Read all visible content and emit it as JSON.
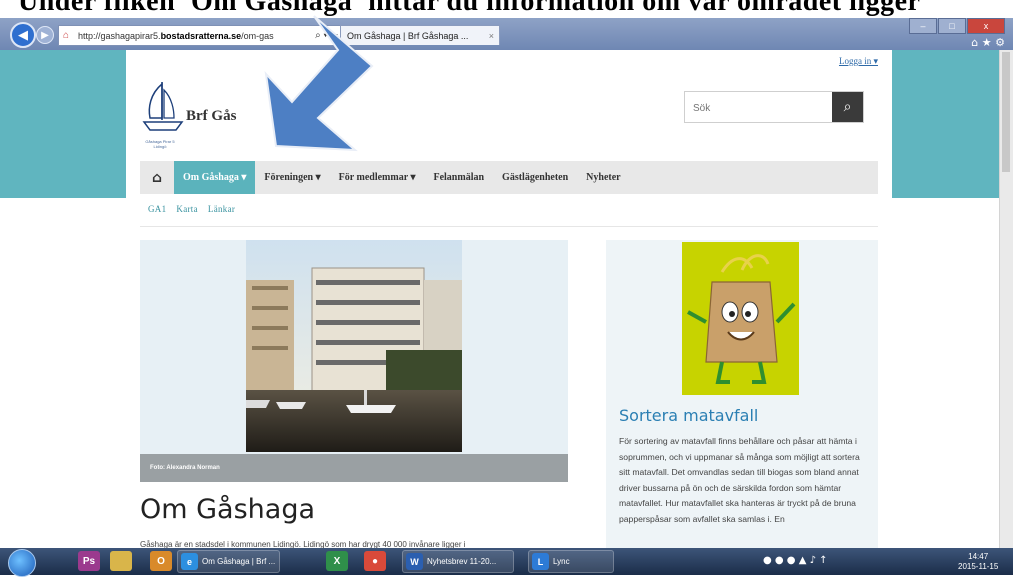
{
  "caption": "Under fliken 'Om Gåshaga' hittar du information om var området ligger",
  "browser": {
    "url_plain": "http://gashagapirar5.",
    "url_bold": "bostadsratterna.se",
    "url_rest": "/om-gas",
    "url_tools": "⌕ ▾ ☰",
    "tab_title": "Om Gåshaga | Brf Gåshaga ...",
    "tab_close": "×",
    "win_min": "–",
    "win_max": "□",
    "win_close": "x",
    "toolbar_icons": "⌂ ★ ⚙"
  },
  "header": {
    "login": "Logga in ▾",
    "logo_text": "Brf Gås",
    "logo_sub": "Gåshaga Pirar 5 Lidingö",
    "search_placeholder": "Sök",
    "search_icon": "⌕"
  },
  "nav": {
    "home_icon": "⌂",
    "items": [
      {
        "label": "Om Gåshaga ▾",
        "active": true
      },
      {
        "label": "Föreningen ▾",
        "active": false
      },
      {
        "label": "För medlemmar ▾",
        "active": false
      },
      {
        "label": "Felanmälan",
        "active": false
      },
      {
        "label": "Gästlägenheten",
        "active": false
      },
      {
        "label": "Nyheter",
        "active": false
      }
    ]
  },
  "subnav": [
    "GA1",
    "Karta",
    "Länkar"
  ],
  "hero": {
    "photo_caption": "Foto: Alexandra Norman"
  },
  "main": {
    "title": "Om Gåshaga",
    "intro": "Gåshaga är en stadsdel i kommunen Lidingö. Lidingö som har drygt 40 000 invånare ligger i"
  },
  "sidebar": {
    "title": "Sortera matavfall",
    "text": "För sortering av matavfall finns behållare och påsar att hämta i soprummen, och vi uppmanar så många som möjligt att sortera sitt matavfall. Det omvandlas sedan till biogas som bland annat driver bussarna på ön och de särskilda fordon som hämtar matavfallet. Hur matavfallet ska hanteras är tryckt på de bruna papperspåsar som avfallet ska samlas i. En"
  },
  "taskbar": {
    "tb_ps": "Ps",
    "tb_ol": "O",
    "tb_xl": "X",
    "tb_chrome": "●",
    "buttons": [
      {
        "label": "Om Gåshaga | Brf ...",
        "icon": "e",
        "color": "#2c8fe0"
      },
      {
        "label": "Nyhetsbrev 11-20...",
        "icon": "W",
        "color": "#2b5fb0"
      },
      {
        "label": "Lync",
        "icon": "L",
        "color": "#2d7bd6"
      }
    ],
    "tray_icons": "● ● ● ▲ ♪ ↑",
    "time": "14:47",
    "date": "2015-11-15"
  },
  "colors": {
    "teal": "#60b5bf",
    "nav_active": "#5bb3bc",
    "sidebar_title": "#2b7fb3",
    "arrow": "#4d7fc4"
  }
}
